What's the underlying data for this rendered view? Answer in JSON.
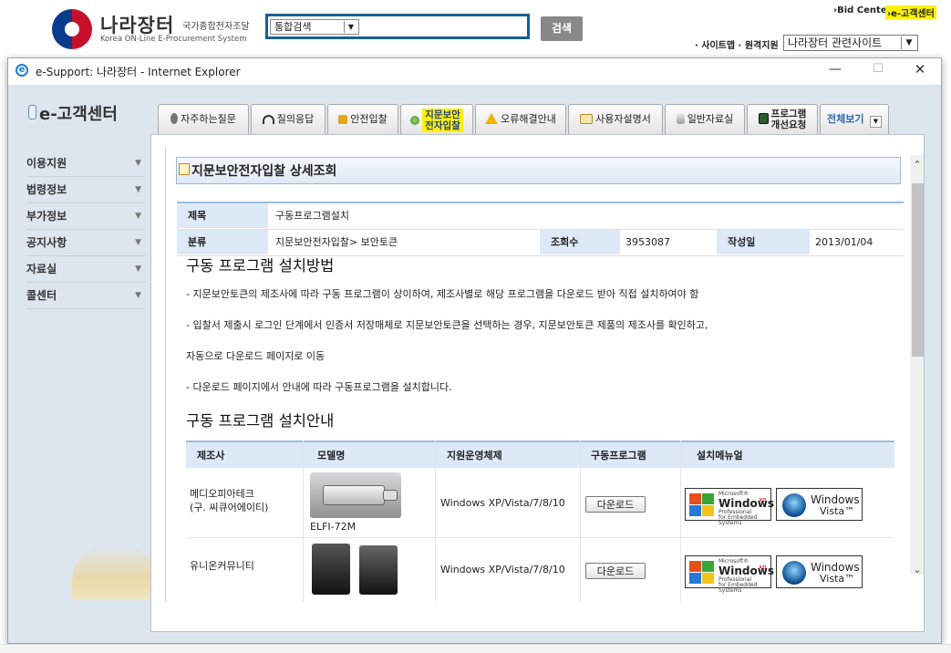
{
  "site_header": {
    "logo_title": "나라장터",
    "logo_sub1": "국가종합전자조달",
    "logo_sub2": "Korea ON-Line E-Procurement System",
    "search_select": "통합검색",
    "search_button": "검색",
    "bid_center": "›Bid Center",
    "ecenter_link": "›e-고객센터",
    "sitemap_links": "· 사이트맵 · 원격지원",
    "related_select": "나라장터 관련사이트"
  },
  "window": {
    "title": "e-Support: 나라장터 - Internet Explorer",
    "minimize": "—",
    "maximize": "☐",
    "close": "✕"
  },
  "ecenter": {
    "heading": "e-고객센터"
  },
  "tabs": [
    {
      "label": "자주하는질문",
      "icon": "microphone-icon"
    },
    {
      "label": "질의응답",
      "icon": "headset-icon"
    },
    {
      "label": "안전입찰",
      "icon": "lock-icon"
    },
    {
      "label_line1": "지문보안",
      "label_line2": "전자입찰",
      "icon": "fingerprint-icon"
    },
    {
      "label": "오류해결안내",
      "icon": "warning-icon"
    },
    {
      "label": "사용자설명서",
      "icon": "manual-icon"
    },
    {
      "label": "일반자료실",
      "icon": "database-icon"
    },
    {
      "label_line1": "프로그램",
      "label_line2": "개선요청",
      "icon": "program-icon"
    },
    {
      "label": "전체보기",
      "icon": "dropdown-icon"
    }
  ],
  "sidebar": {
    "items": [
      {
        "label": "이용지원"
      },
      {
        "label": "법령정보"
      },
      {
        "label": "부가정보"
      },
      {
        "label": "공지사항"
      },
      {
        "label": "자료실"
      },
      {
        "label": "콜센터"
      }
    ]
  },
  "detail": {
    "heading": "지문보안전자입찰 상세조회",
    "title_label": "제목",
    "title_value": "구동프로그램설치",
    "category_label": "분류",
    "category_value": "지문보안전자입찰> 보안토큰",
    "views_label": "조회수",
    "views_value": "3953087",
    "date_label": "작성일",
    "date_value": "2013/01/04",
    "method_heading": "구동 프로그램 설치방법",
    "para1": "- 지문보안토큰의 제조사에 따라 구동 프로그램이 상이하여, 제조사별로 해당 프로그램을 다운로드 받아 직접 설치하여야 함",
    "para2": "- 입찰서 제출시 로그인 단계에서 인증서 저장매체로 지문보안토큰을 선택하는 경우, 지문보안토큰 제품의 제조사를 확인하고,",
    "para3": "자동으로 다운로드 페이지로 이동",
    "para4": "- 다운로드 페이지에서 안내에 따라 구동프로그램을 설치합니다.",
    "guide_heading": "구동 프로그램 설치안내"
  },
  "download_table": {
    "headers": [
      "제조사",
      "모델명",
      "지원운영체제",
      "구동프로그램",
      "설치메뉴얼"
    ],
    "rows": [
      {
        "maker_line1": "메디오피아테크",
        "maker_line2": "(구. 씨큐어에이티)",
        "model": "ELFI-72M",
        "os": "Windows XP/Vista/7/8/10",
        "download_label": "다운로드",
        "xp_badge": "Windows",
        "xp_sup": "xp",
        "xp_small1": "Microsoft®",
        "xp_small2": "Professional",
        "xp_small3": "for Embedded Systems",
        "vista_line1": "Windows",
        "vista_line2": "Vista™"
      },
      {
        "maker_line1": "유니온커뮤니티",
        "os": "Windows XP/Vista/7/8/10",
        "download_label": "다운로드",
        "xp_badge": "Windows",
        "xp_sup": "xp",
        "xp_small1": "Microsoft®",
        "xp_small2": "Professional",
        "xp_small3": "for Embedded Systems",
        "vista_line1": "Windows",
        "vista_line2": "Vista™"
      }
    ]
  },
  "colors": {
    "accent_blue": "#1b5d95",
    "highlight_yellow": "#fff200",
    "table_header_bg": "#dde9f7"
  }
}
